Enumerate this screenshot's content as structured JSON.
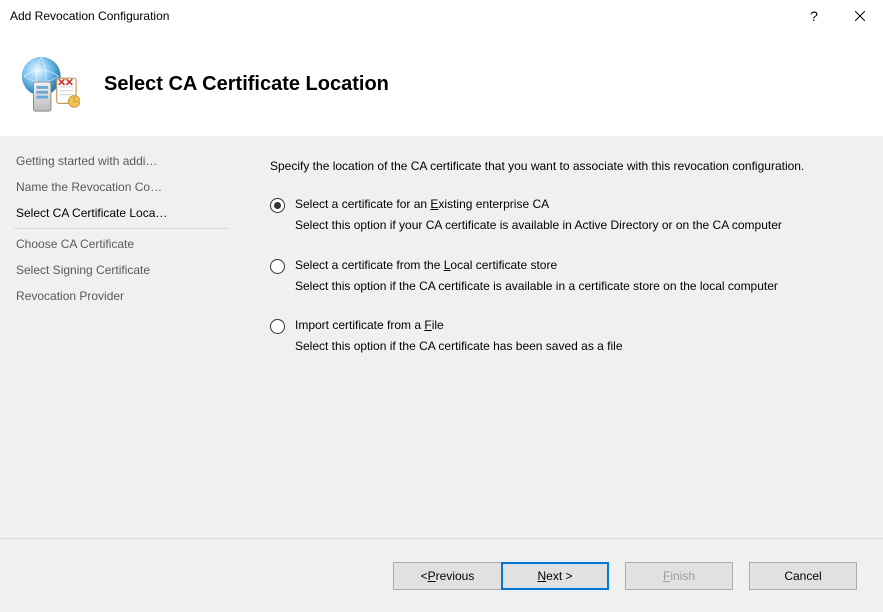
{
  "window": {
    "title": "Add Revocation Configuration"
  },
  "header": {
    "page_title": "Select CA Certificate Location"
  },
  "sidebar": {
    "items": [
      {
        "label": "Getting started with addi…"
      },
      {
        "label": "Name the Revocation Co…"
      },
      {
        "label": "Select CA Certificate Loca…"
      },
      {
        "label": "Choose CA Certificate"
      },
      {
        "label": "Select Signing Certificate"
      },
      {
        "label": "Revocation Provider"
      }
    ],
    "active_index": 2
  },
  "main": {
    "intro": "Specify the location of the CA certificate that you want to associate with this revocation configuration.",
    "options": [
      {
        "label_pre": "Select a certificate for an ",
        "accel": "E",
        "label_post": "xisting enterprise CA",
        "desc": "Select this option if your CA certificate is available in Active Directory or on the CA computer",
        "checked": true
      },
      {
        "label_pre": "Select a certificate from the ",
        "accel": "L",
        "label_post": "ocal certificate store",
        "desc": "Select this option if the CA certificate is available in a certificate store on the local computer",
        "checked": false
      },
      {
        "label_pre": "Import certificate from a ",
        "accel": "F",
        "label_post": "ile",
        "desc": "Select this option if the CA certificate has been saved as a file",
        "checked": false
      }
    ]
  },
  "footer": {
    "prev_pre": "< ",
    "prev_accel": "P",
    "prev_post": "revious",
    "next_accel": "N",
    "next_post": "ext >",
    "finish_accel": "F",
    "finish_pre": "",
    "finish_post": "inish",
    "cancel": "Cancel"
  }
}
